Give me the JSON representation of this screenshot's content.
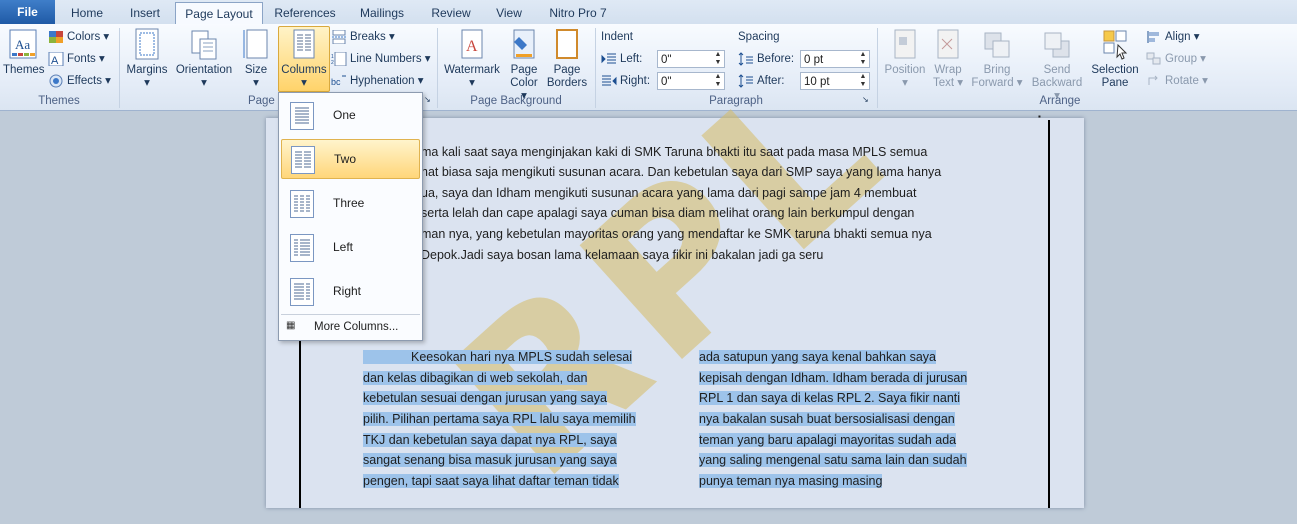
{
  "tabs": [
    "File",
    "Home",
    "Insert",
    "Page Layout",
    "References",
    "Mailings",
    "Review",
    "View",
    "Nitro Pro 7"
  ],
  "active_tab": "Page Layout",
  "themes_group": {
    "label": "Themes",
    "themes_btn": "Themes",
    "colors": "Colors",
    "fonts": "Fonts",
    "effects": "Effects"
  },
  "page_setup": {
    "label": "Page Setup",
    "margins": "Margins",
    "orientation": "Orientation",
    "size": "Size",
    "columns": "Columns",
    "breaks": "Breaks",
    "line_numbers": "Line Numbers",
    "hyphenation": "Hyphenation"
  },
  "page_background": {
    "label": "Page Background",
    "watermark": "Watermark",
    "page_color_1": "Page",
    "page_color_2": "Color",
    "page_borders_1": "Page",
    "page_borders_2": "Borders"
  },
  "paragraph": {
    "label": "Paragraph",
    "indent": "Indent",
    "left_label": "Left:",
    "left_value": "0\"",
    "right_label": "Right:",
    "right_value": "0\"",
    "spacing": "Spacing",
    "before_label": "Before:",
    "before_value": "0 pt",
    "after_label": "After:",
    "after_value": "10 pt"
  },
  "arrange": {
    "label": "Arrange",
    "position_1": "Position",
    "wrap_1": "Wrap",
    "wrap_2": "Text",
    "bring_1": "Bring",
    "bring_2": "Forward",
    "send_1": "Send",
    "send_2": "Backward",
    "selection_1": "Selection",
    "selection_2": "Pane",
    "align": "Align",
    "group": "Group",
    "rotate": "Rotate"
  },
  "columns_menu": {
    "items": [
      "One",
      "Two",
      "Three",
      "Left",
      "Right"
    ],
    "highlighted": "Two",
    "more": "More Columns..."
  },
  "document": {
    "top_lines": [
      "ma kali saat saya menginjakan kaki di SMK Taruna bhakti itu saat pada masa MPLS semua",
      "hat biasa saja mengikuti susunan acara. Dan kebetulan saya dari SMP saya yang lama hanya",
      "ua, saya dan Idham mengikuti susunan acara yang lama dari pagi sampe jam 4  membuat",
      "serta lelah dan cape apalagi saya cuman bisa diam melihat orang lain  berkumpul dengan",
      "man nya, yang kebetulan mayoritas orang yang mendaftar ke SMK taruna bhakti semua nya",
      "Depok.Jadi saya bosan lama  kelamaan saya fikir ini  bakalan jadi ga seru"
    ],
    "col1_lines": [
      "Keesokan hari nya MPLS sudah selesai",
      "dan kelas dibagikan di web sekolah, dan",
      "kebetulan sesuai dengan jurusan yang saya",
      "pilih.  Pilihan pertama saya RPL lalu  saya memilih",
      "TKJ dan kebetulan saya dapat nya RPL, saya",
      "sangat senang bisa masuk jurusan yang saya",
      "pengen, tapi saat saya lihat daftar teman tidak"
    ],
    "col2_lines": [
      "ada satupun yang saya kenal bahkan saya",
      "kepisah dengan Idham. Idham berada di jurusan",
      "RPL 1  dan saya di kelas RPL 2.  Saya fikir  nanti",
      "nya bakalan susah buat bersosialisasi dengan",
      "teman yang baru apalagi mayoritas sudah ada",
      "yang saling mengenal satu sama lain  dan sudah",
      "punya teman nya masing masing"
    ]
  }
}
